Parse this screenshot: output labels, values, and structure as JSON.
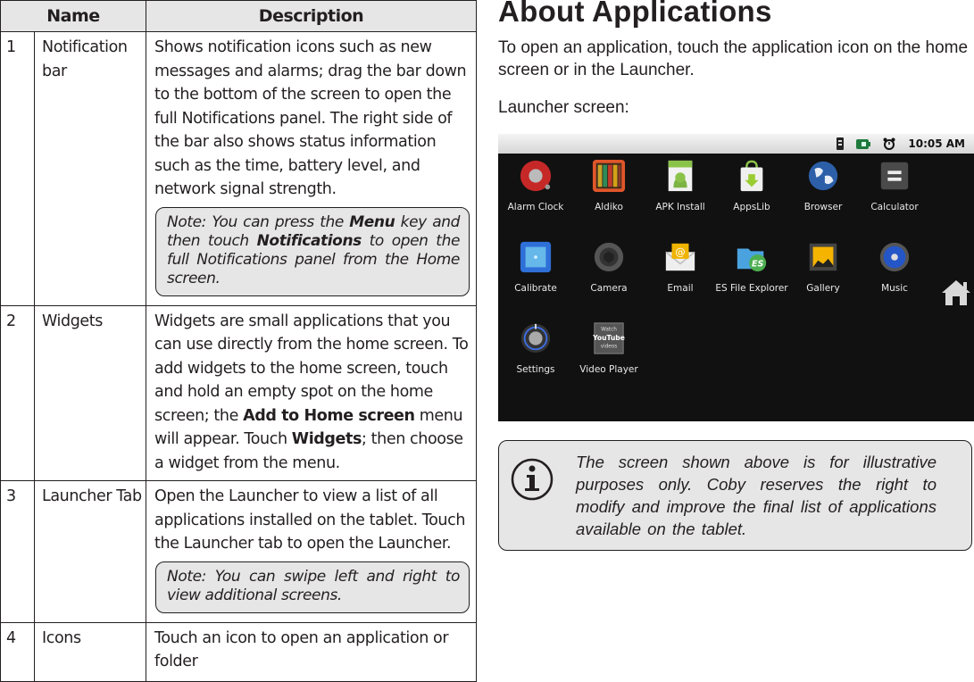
{
  "table": {
    "headers": {
      "name": "Name",
      "description": "Description"
    },
    "rows": [
      {
        "num": "1",
        "name": "Notification bar",
        "desc": "Shows notification icons such as new messages and alarms; drag the bar down to the bottom of the screen to open the full Notifications panel. The right side of the bar also shows status information such as the time, battery level, and network signal strength.",
        "note": {
          "pre": "Note: You can press the ",
          "b1": "Menu",
          "mid": " key and then touch ",
          "b2": "Notifications",
          "post": " to open the full Notifications panel from the Home screen."
        }
      },
      {
        "num": "2",
        "name": "Widgets",
        "desc_pre": "Widgets are small applications that you can use directly from the home screen. To add widgets to the home screen, touch and hold an empty spot on the home screen; the ",
        "desc_b1": "Add to Home screen",
        "desc_mid": " menu will appear. Touch ",
        "desc_b2": "Widgets",
        "desc_post": "; then choose a widget from the menu."
      },
      {
        "num": "3",
        "name": "Launcher Tab",
        "desc": "Open the Launcher to view a list of all applications installed on the tablet. Touch the Launcher tab to open the Launcher.",
        "note": "Note: You can swipe left and right to view additional screens."
      },
      {
        "num": "4",
        "name": "Icons",
        "desc": "Touch an icon to open an application or folder"
      }
    ]
  },
  "section": {
    "title": "About Applications",
    "intro": "To open an application, touch the application icon on the home screen or in the Launcher.",
    "subtitle": "Launcher screen:"
  },
  "launcher": {
    "status_time": "10:05 AM",
    "status_icons": [
      "signal-icon",
      "battery-icon",
      "alarm-icon"
    ],
    "apps": [
      {
        "label": "Alarm Clock",
        "icon": "alarm-clock-icon"
      },
      {
        "label": "Aldiko",
        "icon": "aldiko-icon"
      },
      {
        "label": "APK Install",
        "icon": "apk-install-icon"
      },
      {
        "label": "AppsLib",
        "icon": "appslib-icon"
      },
      {
        "label": "Browser",
        "icon": "browser-icon"
      },
      {
        "label": "Calculator",
        "icon": "calculator-icon"
      },
      {
        "label": "Calibrate",
        "icon": "calibrate-icon"
      },
      {
        "label": "Camera",
        "icon": "camera-icon"
      },
      {
        "label": "Email",
        "icon": "email-icon"
      },
      {
        "label": "ES File Explorer",
        "icon": "es-file-explorer-icon"
      },
      {
        "label": "Gallery",
        "icon": "gallery-icon"
      },
      {
        "label": "Music",
        "icon": "music-icon"
      },
      {
        "label": "Settings",
        "icon": "settings-icon"
      },
      {
        "label": "Video Player",
        "icon": "video-player-icon"
      }
    ],
    "youtube_icon_text": {
      "top": "Watch",
      "mid": "YouTube",
      "bottom": "videos"
    }
  },
  "info_note": "The screen shown above is for illustrative purposes only. Coby reserves the right to modify  and improve the final list of applications available on the tablet.",
  "colors": {
    "note_bg": "#e6e6e6",
    "text": "#231f20",
    "screen_bg": "#111111"
  }
}
